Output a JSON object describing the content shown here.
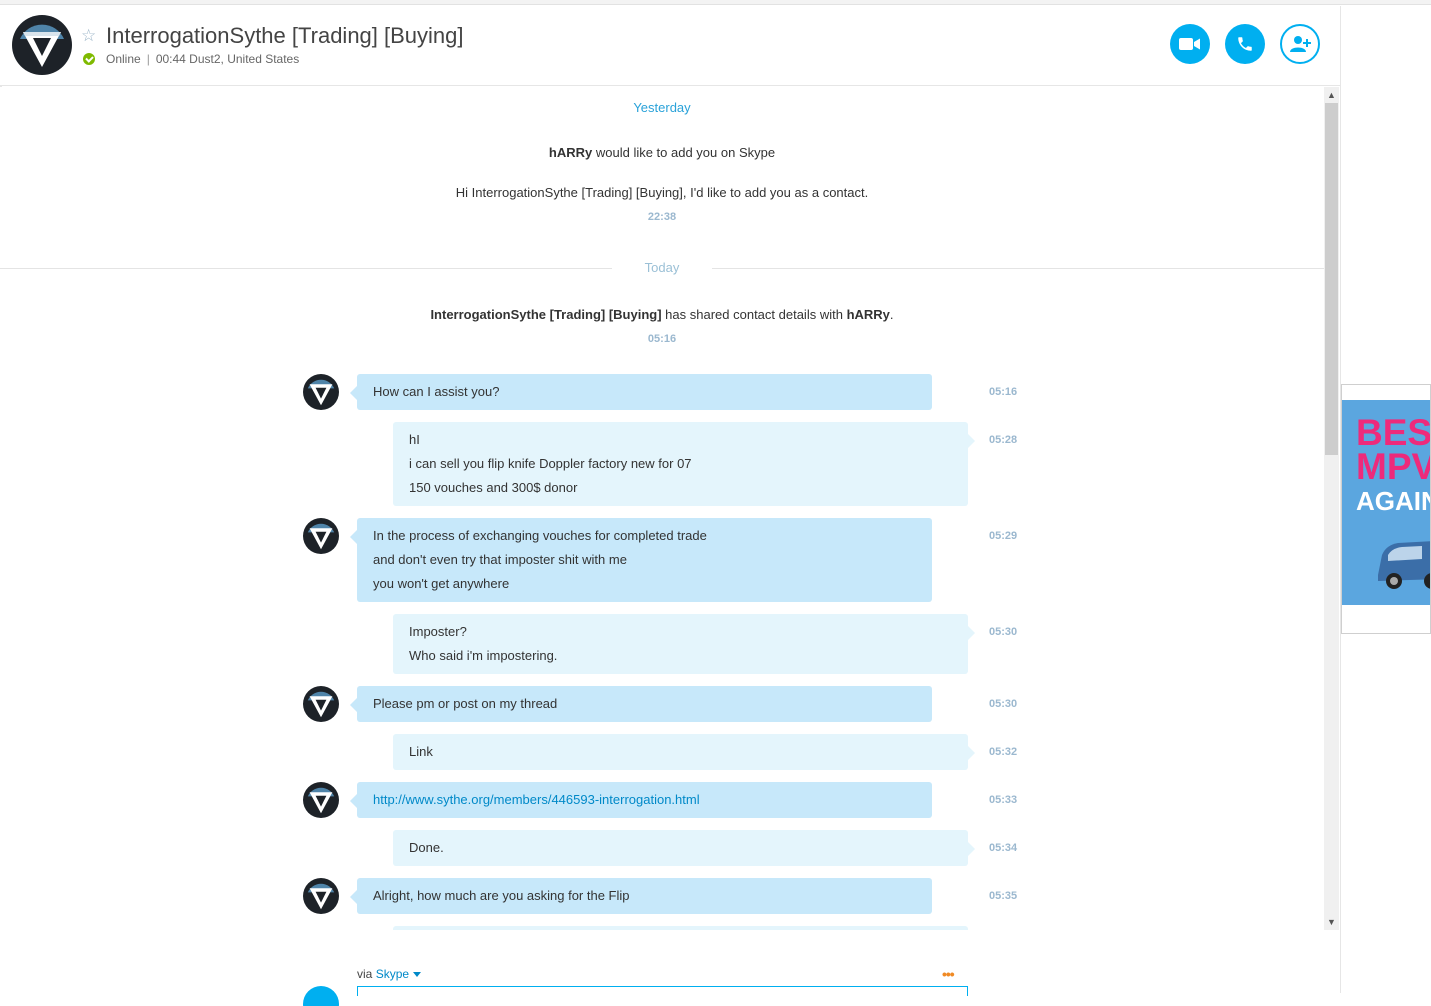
{
  "header": {
    "contact_name": "InterrogationSythe [Trading] [Buying]",
    "status": "Online",
    "status_detail": "00:44 Dust2, United States",
    "separator": "|",
    "colors": {
      "accent": "#00aff0",
      "online": "#7fba00"
    }
  },
  "conversation": {
    "yesterday_label": "Yesterday",
    "contact_request": {
      "sender": "hARRy",
      "text": "would like to add you on Skype",
      "message": "Hi InterrogationSythe [Trading] [Buying], I'd like to add you as a contact.",
      "time": "22:38"
    },
    "today_label": "Today",
    "shared_contact": {
      "name": "InterrogationSythe [Trading] [Buying]",
      "text": "has shared contact details with",
      "target": "hARRy",
      "period": ".",
      "time": "05:16"
    },
    "messages": [
      {
        "lines": [
          "How can I assist you?"
        ],
        "time": "05:16"
      },
      {
        "lines": [
          "hI",
          "i can sell you flip knife Doppler factory new for 07",
          "150 vouches and 300$ donor"
        ],
        "time": "05:28"
      },
      {
        "lines": [
          "In the process of exchanging vouches for completed trade",
          "and don't even try that imposter shit with me",
          "you won't get anywhere"
        ],
        "time": "05:29"
      },
      {
        "lines": [
          "Imposter?",
          "Who said i'm impostering."
        ],
        "time": "05:30"
      },
      {
        "lines": [
          "Please pm or post on my thread"
        ],
        "time": "05:30"
      },
      {
        "lines": [
          "Link"
        ],
        "time": "05:32"
      },
      {
        "lines": [
          "http://www.sythe.org/members/446593-interrogation.html"
        ],
        "time": "05:33"
      },
      {
        "lines": [
          "Done."
        ],
        "time": "05:34"
      },
      {
        "lines": [
          "Alright, how much are you asking for the Flip"
        ],
        "time": "05:35"
      }
    ]
  },
  "compose": {
    "via_label": "via",
    "via_service": "Skype",
    "more_label": "•••"
  },
  "scrollbar": {
    "up": "▲",
    "down": "▼"
  },
  "ad": {
    "line1": "BEST",
    "line2": "MPV",
    "line3": "AGAIN",
    "colors": {
      "headline": "#ee2a7b",
      "background": "#5ba6df"
    }
  }
}
